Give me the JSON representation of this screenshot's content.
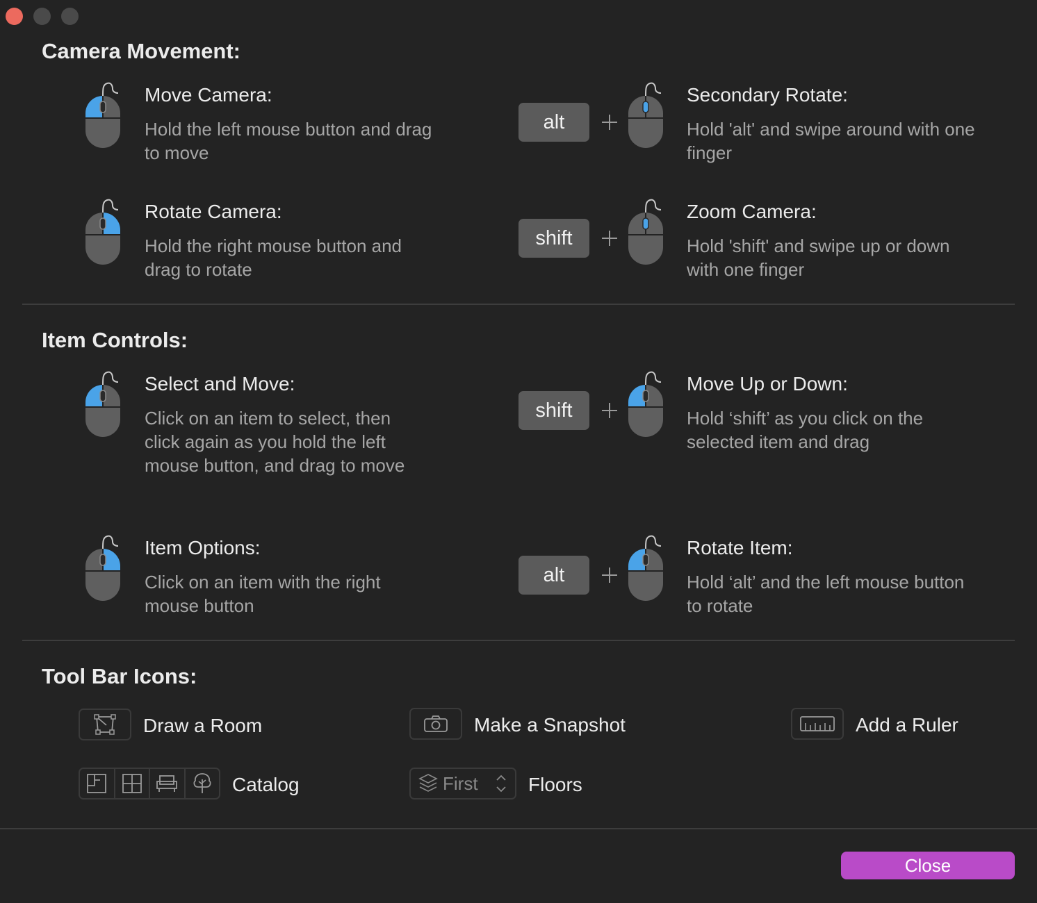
{
  "window": {
    "controls": [
      "close",
      "minimize",
      "zoom"
    ]
  },
  "sections": {
    "camera": {
      "title": "Camera Movement:",
      "move": {
        "title": "Move Camera:",
        "desc": "Hold the left mouse button and drag to move"
      },
      "rotate": {
        "title": "Rotate Camera:",
        "desc": "Hold the right mouse button and drag to rotate"
      },
      "secondary": {
        "key": "alt",
        "title": "Secondary Rotate:",
        "desc": "Hold 'alt' and swipe around with one finger"
      },
      "zoom": {
        "key": "shift",
        "title": "Zoom Camera:",
        "desc": "Hold 'shift' and swipe up or down with one finger"
      }
    },
    "items": {
      "title": "Item Controls:",
      "select": {
        "title": "Select and Move:",
        "desc": "Click on an item to select, then click again as you hold the left mouse button, and drag to move"
      },
      "options": {
        "title": "Item Options:",
        "desc": "Click on an item with the right mouse button"
      },
      "updown": {
        "key": "shift",
        "title": "Move Up or Down:",
        "desc": "Hold ‘shift’ as you click on the selected item and drag"
      },
      "rotate": {
        "key": "alt",
        "title": "Rotate Item:",
        "desc": "Hold ‘alt’ and the left mouse button to rotate"
      }
    },
    "toolbar": {
      "title": "Tool Bar Icons:",
      "draw_room": "Draw a Room",
      "snapshot": "Make a Snapshot",
      "ruler": "Add a Ruler",
      "catalog": "Catalog",
      "floors": "Floors",
      "floor_value": "First"
    }
  },
  "footer": {
    "close_label": "Close"
  },
  "colors": {
    "accent": "#b94bc8",
    "mouse_highlight": "#4aa3e8",
    "mouse_body": "#5f5f5f"
  }
}
